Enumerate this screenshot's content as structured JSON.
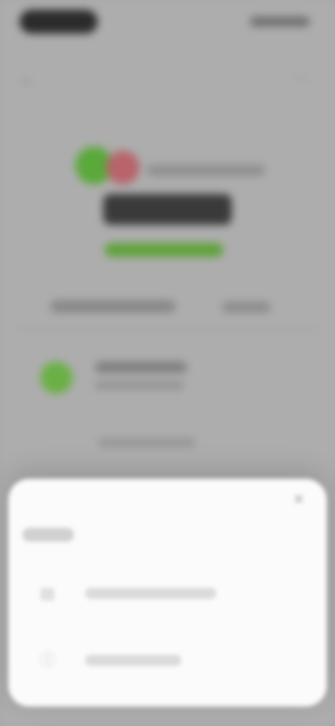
{
  "status_bar": {
    "time": "",
    "indicators": ""
  },
  "header": {
    "back_icon": "back-arrow-icon",
    "more_icon": "more-icon"
  },
  "asset": {
    "pair_label": "",
    "price": "",
    "change": "",
    "flag_colors": [
      "#5aa93b",
      "#b8646a"
    ]
  },
  "tabs": [
    {
      "label": ""
    },
    {
      "label": ""
    }
  ],
  "feature": {
    "title": "",
    "subtitle": "",
    "icon_color": "#6ab045"
  },
  "link": {
    "text": ""
  },
  "sheet": {
    "title": "",
    "items": [
      {
        "label": "",
        "icon": "chart-icon"
      },
      {
        "label": "",
        "icon": "info-icon"
      }
    ]
  },
  "colors": {
    "accent": "#5fa23a",
    "sheet_bg": "#fbfbfb",
    "backdrop": "#adadad"
  }
}
